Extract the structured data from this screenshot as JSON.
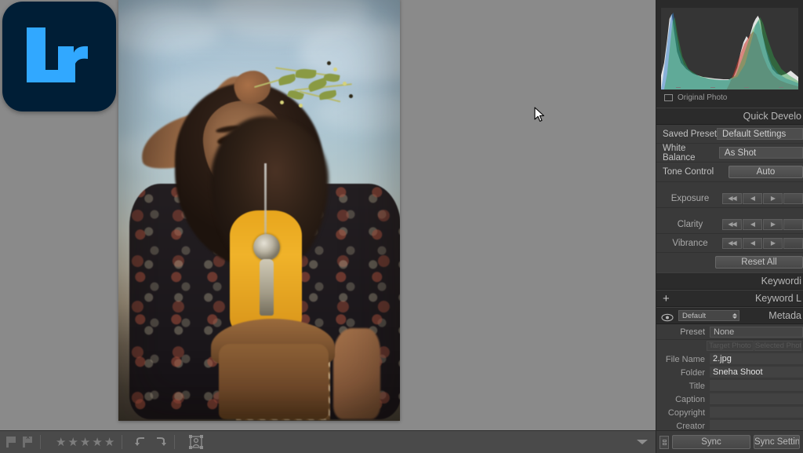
{
  "app": {
    "name": "Adobe Lightroom Classic",
    "logo_text": "Lr",
    "logo_bg": "#001e36",
    "logo_fg": "#31a8ff"
  },
  "histogram": {
    "original_photo_label": "Original Photo",
    "icon": "rectangle-icon"
  },
  "panels": {
    "quick_develop": {
      "title": "Quick Develo",
      "rows": {
        "saved_preset_label": "Saved Preset",
        "saved_preset_value": "Default Settings",
        "white_balance_label": "White Balance",
        "white_balance_value": "As Shot",
        "tone_control_label": "Tone Control",
        "auto_label": "Auto",
        "exposure_label": "Exposure",
        "clarity_label": "Clarity",
        "vibrance_label": "Vibrance",
        "reset_all_label": "Reset All"
      },
      "stepper_glyphs": {
        "double_left": "◀◀",
        "left": "◀",
        "right": "▶"
      }
    },
    "keywording": {
      "title": "Keywordi"
    },
    "keyword_list": {
      "title": "Keyword L",
      "add_label": "+"
    },
    "metadata": {
      "title": "Metada",
      "view_select_value": "Default",
      "preset_label": "Preset",
      "preset_value": "None",
      "target_photo_label": "Target Photo",
      "selected_photos_label": "Selected Photos",
      "fields": [
        {
          "label": "File Name",
          "value": "2.jpg"
        },
        {
          "label": "Folder",
          "value": "Sneha Shoot"
        },
        {
          "label": "Title",
          "value": ""
        },
        {
          "label": "Caption",
          "value": ""
        },
        {
          "label": "Copyright",
          "value": ""
        },
        {
          "label": "Creator",
          "value": ""
        }
      ]
    }
  },
  "toolbar": {
    "flag_icon": "flag-pick-icon",
    "reject_icon": "flag-reject-icon",
    "stars": [
      "★",
      "★",
      "★",
      "★",
      "★"
    ],
    "rotate_left_icon": "rotate-left-icon",
    "rotate_right_icon": "rotate-right-icon",
    "people_icon": "people-view-icon",
    "dropdown_icon": "chevron-down-icon"
  },
  "bottom_right": {
    "sync_toggle_icon": "auto-sync-toggle-icon",
    "sync_label": "Sync",
    "sync_settings_label": "Sync Settin"
  },
  "photo": {
    "alt": "Woman in yellow top and dark paisley kimono against blue sky"
  }
}
